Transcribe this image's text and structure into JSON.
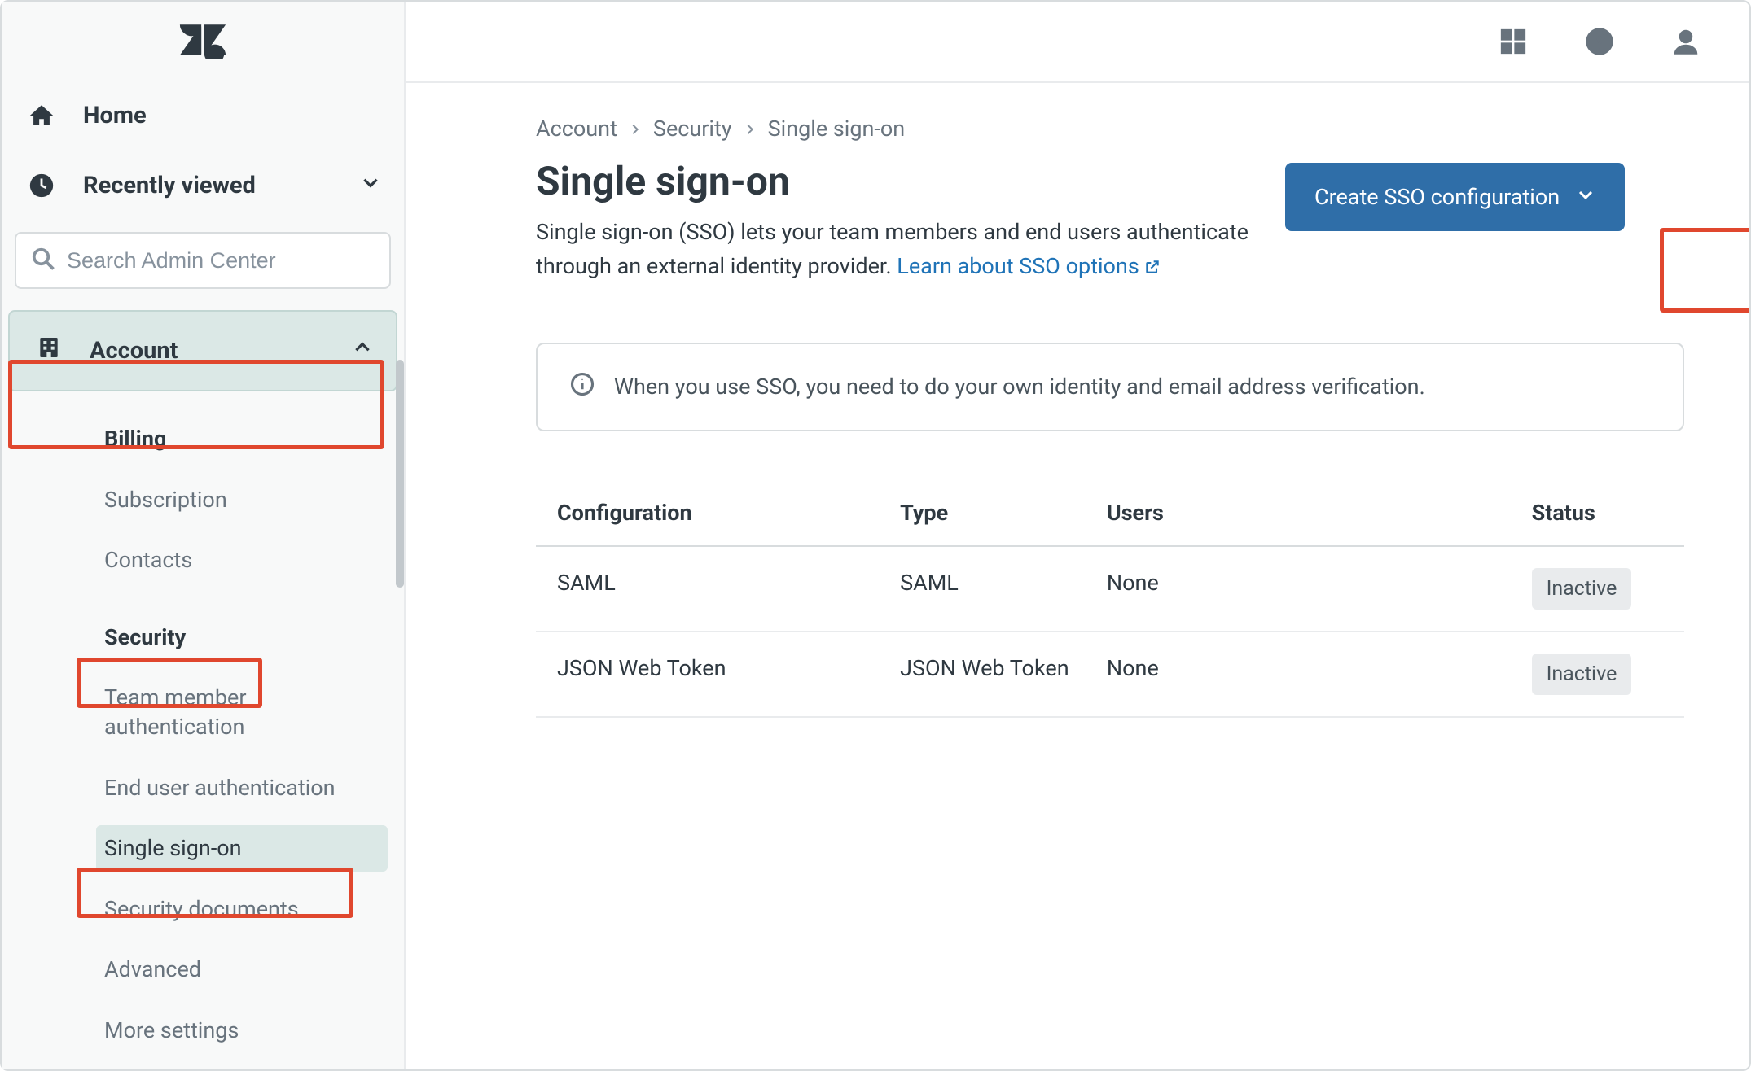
{
  "sidebar": {
    "home_label": "Home",
    "recent_label": "Recently viewed",
    "search_placeholder": "Search Admin Center",
    "section_label": "Account",
    "items": [
      {
        "label": "Billing"
      },
      {
        "label": "Subscription"
      },
      {
        "label": "Contacts"
      },
      {
        "label": "Security"
      },
      {
        "label": "Team member authentication"
      },
      {
        "label": "End user authentication"
      },
      {
        "label": "Single sign-on"
      },
      {
        "label": "Security documents"
      },
      {
        "label": "Advanced"
      },
      {
        "label": "More settings"
      }
    ]
  },
  "breadcrumb": {
    "a": "Account",
    "b": "Security",
    "c": "Single sign-on"
  },
  "page": {
    "title": "Single sign-on",
    "desc_prefix": "Single sign-on (SSO) lets your team members and end users authenticate through an external identity provider. ",
    "desc_link": "Learn about SSO options",
    "create_btn": "Create SSO configuration",
    "info_text": "When you use SSO, you need to do your own identity and email address verification."
  },
  "table": {
    "headers": {
      "config": "Configuration",
      "type": "Type",
      "users": "Users",
      "status": "Status"
    },
    "rows": [
      {
        "config": "SAML",
        "type": "SAML",
        "users": "None",
        "status": "Inactive"
      },
      {
        "config": "JSON Web Token",
        "type": "JSON Web Token",
        "users": "None",
        "status": "Inactive"
      }
    ]
  }
}
